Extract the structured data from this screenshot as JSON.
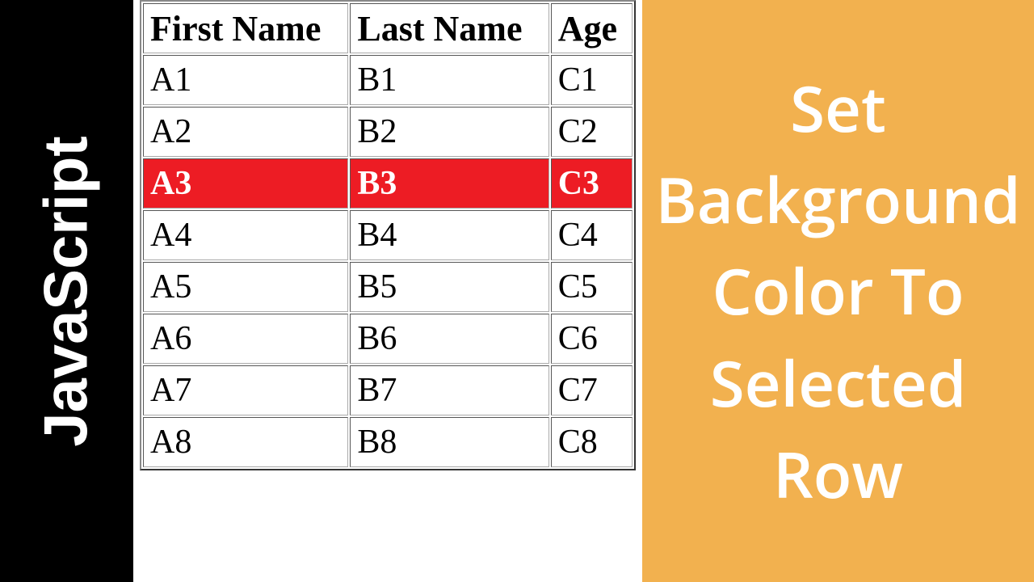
{
  "left": {
    "label": "JavaScript"
  },
  "right": {
    "title": "Set Background Color To Selected Row"
  },
  "table": {
    "headers": [
      "First Name",
      "Last Name",
      "Age"
    ],
    "rows": [
      {
        "cells": [
          "A1",
          "B1",
          "C1"
        ],
        "selected": false
      },
      {
        "cells": [
          "A2",
          "B2",
          "C2"
        ],
        "selected": false
      },
      {
        "cells": [
          "A3",
          "B3",
          "C3"
        ],
        "selected": true
      },
      {
        "cells": [
          "A4",
          "B4",
          "C4"
        ],
        "selected": false
      },
      {
        "cells": [
          "A5",
          "B5",
          "C5"
        ],
        "selected": false
      },
      {
        "cells": [
          "A6",
          "B6",
          "C6"
        ],
        "selected": false
      },
      {
        "cells": [
          "A7",
          "B7",
          "C7"
        ],
        "selected": false
      },
      {
        "cells": [
          "A8",
          "B8",
          "C8"
        ],
        "selected": false
      }
    ],
    "selected_bg": "#ed1c24",
    "selected_fg": "#ffffff"
  }
}
